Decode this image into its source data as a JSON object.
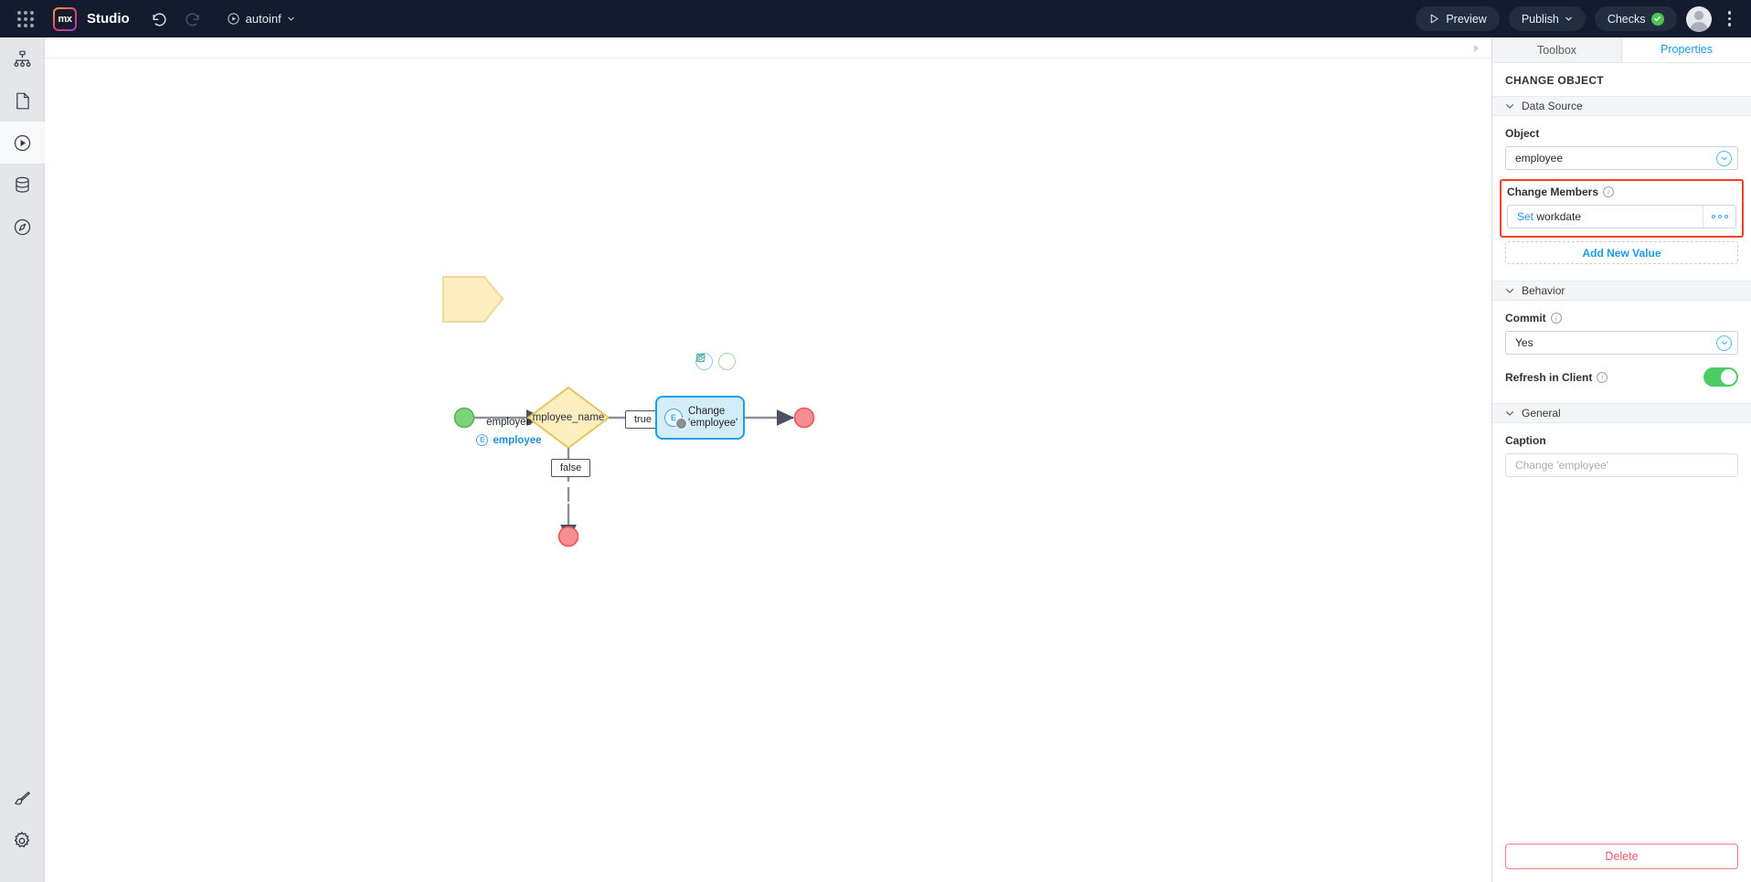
{
  "topbar": {
    "app_name": "Studio",
    "logo_text": "mx",
    "branch": "autoinf",
    "preview_label": "Preview",
    "publish_label": "Publish",
    "checks_label": "Checks",
    "icons": {
      "grid": "app-grid-icon",
      "undo": "undo-icon",
      "redo": "redo-icon",
      "play": "play-circle-icon",
      "kebab": "more-vertical-icon"
    }
  },
  "rail": {
    "items": [
      {
        "name": "sidebar-item-pages",
        "icon": "sitemap-icon",
        "active": false
      },
      {
        "name": "sidebar-item-document",
        "icon": "document-icon",
        "active": false
      },
      {
        "name": "sidebar-item-logic",
        "icon": "play-circle-icon",
        "active": true
      },
      {
        "name": "sidebar-item-data",
        "icon": "database-icon",
        "active": false
      },
      {
        "name": "sidebar-item-navigation",
        "icon": "compass-icon",
        "active": false
      },
      {
        "name": "sidebar-item-styling",
        "icon": "paintbrush-icon",
        "active": false
      },
      {
        "name": "sidebar-item-settings",
        "icon": "gear-icon",
        "active": false
      }
    ]
  },
  "diagram": {
    "parameter": {
      "caption": "employee",
      "type_label": "employee",
      "type_badge": "E"
    },
    "decision": {
      "label": "mployee_name"
    },
    "flows": {
      "true_label": "true",
      "false_label": "false"
    },
    "activity": {
      "line1": "Change",
      "line2": "'employee'",
      "badges": [
        "commit-icon",
        "refresh-icon"
      ]
    }
  },
  "panel": {
    "tabs": [
      {
        "label": "Toolbox",
        "active": false
      },
      {
        "label": "Properties",
        "active": true
      }
    ],
    "title": "CHANGE OBJECT",
    "sections": {
      "data_source": {
        "heading": "Data Source",
        "object_label": "Object",
        "object_value": "employee",
        "change_members_label": "Change Members",
        "member_action": "Set",
        "member_name": "workdate",
        "add_new_value": "Add New Value"
      },
      "behavior": {
        "heading": "Behavior",
        "commit_label": "Commit",
        "commit_value": "Yes",
        "refresh_label": "Refresh in Client",
        "refresh_on": true
      },
      "general": {
        "heading": "General",
        "caption_label": "Caption",
        "caption_value": "",
        "caption_placeholder": "Change 'employee'"
      }
    },
    "delete_label": "Delete"
  },
  "colors": {
    "accent_blue": "#1d9ae5",
    "highlight_red": "#ef4123",
    "toggle_green": "#4ccc63",
    "topbar_dark": "#121c2e",
    "param_yellow": "#fdebb8",
    "node_blue": "#d4edfb"
  }
}
